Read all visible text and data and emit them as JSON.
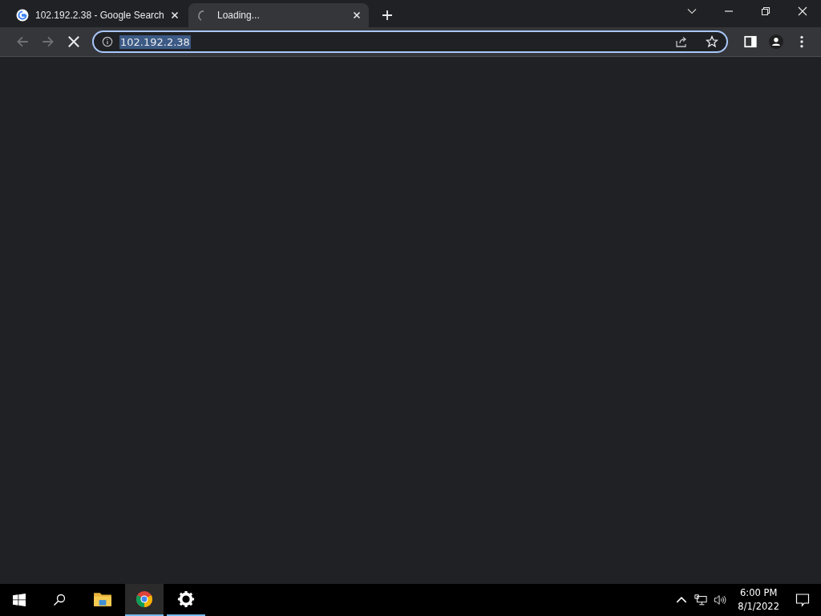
{
  "tabs": [
    {
      "title": "102.192.2.38 - Google Search",
      "selected": false,
      "loading": false
    },
    {
      "title": "Loading...",
      "selected": true,
      "loading": true
    }
  ],
  "address_bar": {
    "value": "102.192.2.38",
    "selected_text": true
  },
  "taskbar": {
    "apps": [
      {
        "kind": "folder",
        "active": false,
        "running": false
      },
      {
        "kind": "chrome",
        "active": true,
        "running": true
      },
      {
        "kind": "settings",
        "active": false,
        "running": true
      }
    ],
    "time": "6:00 PM",
    "date": "8/1/2022"
  }
}
